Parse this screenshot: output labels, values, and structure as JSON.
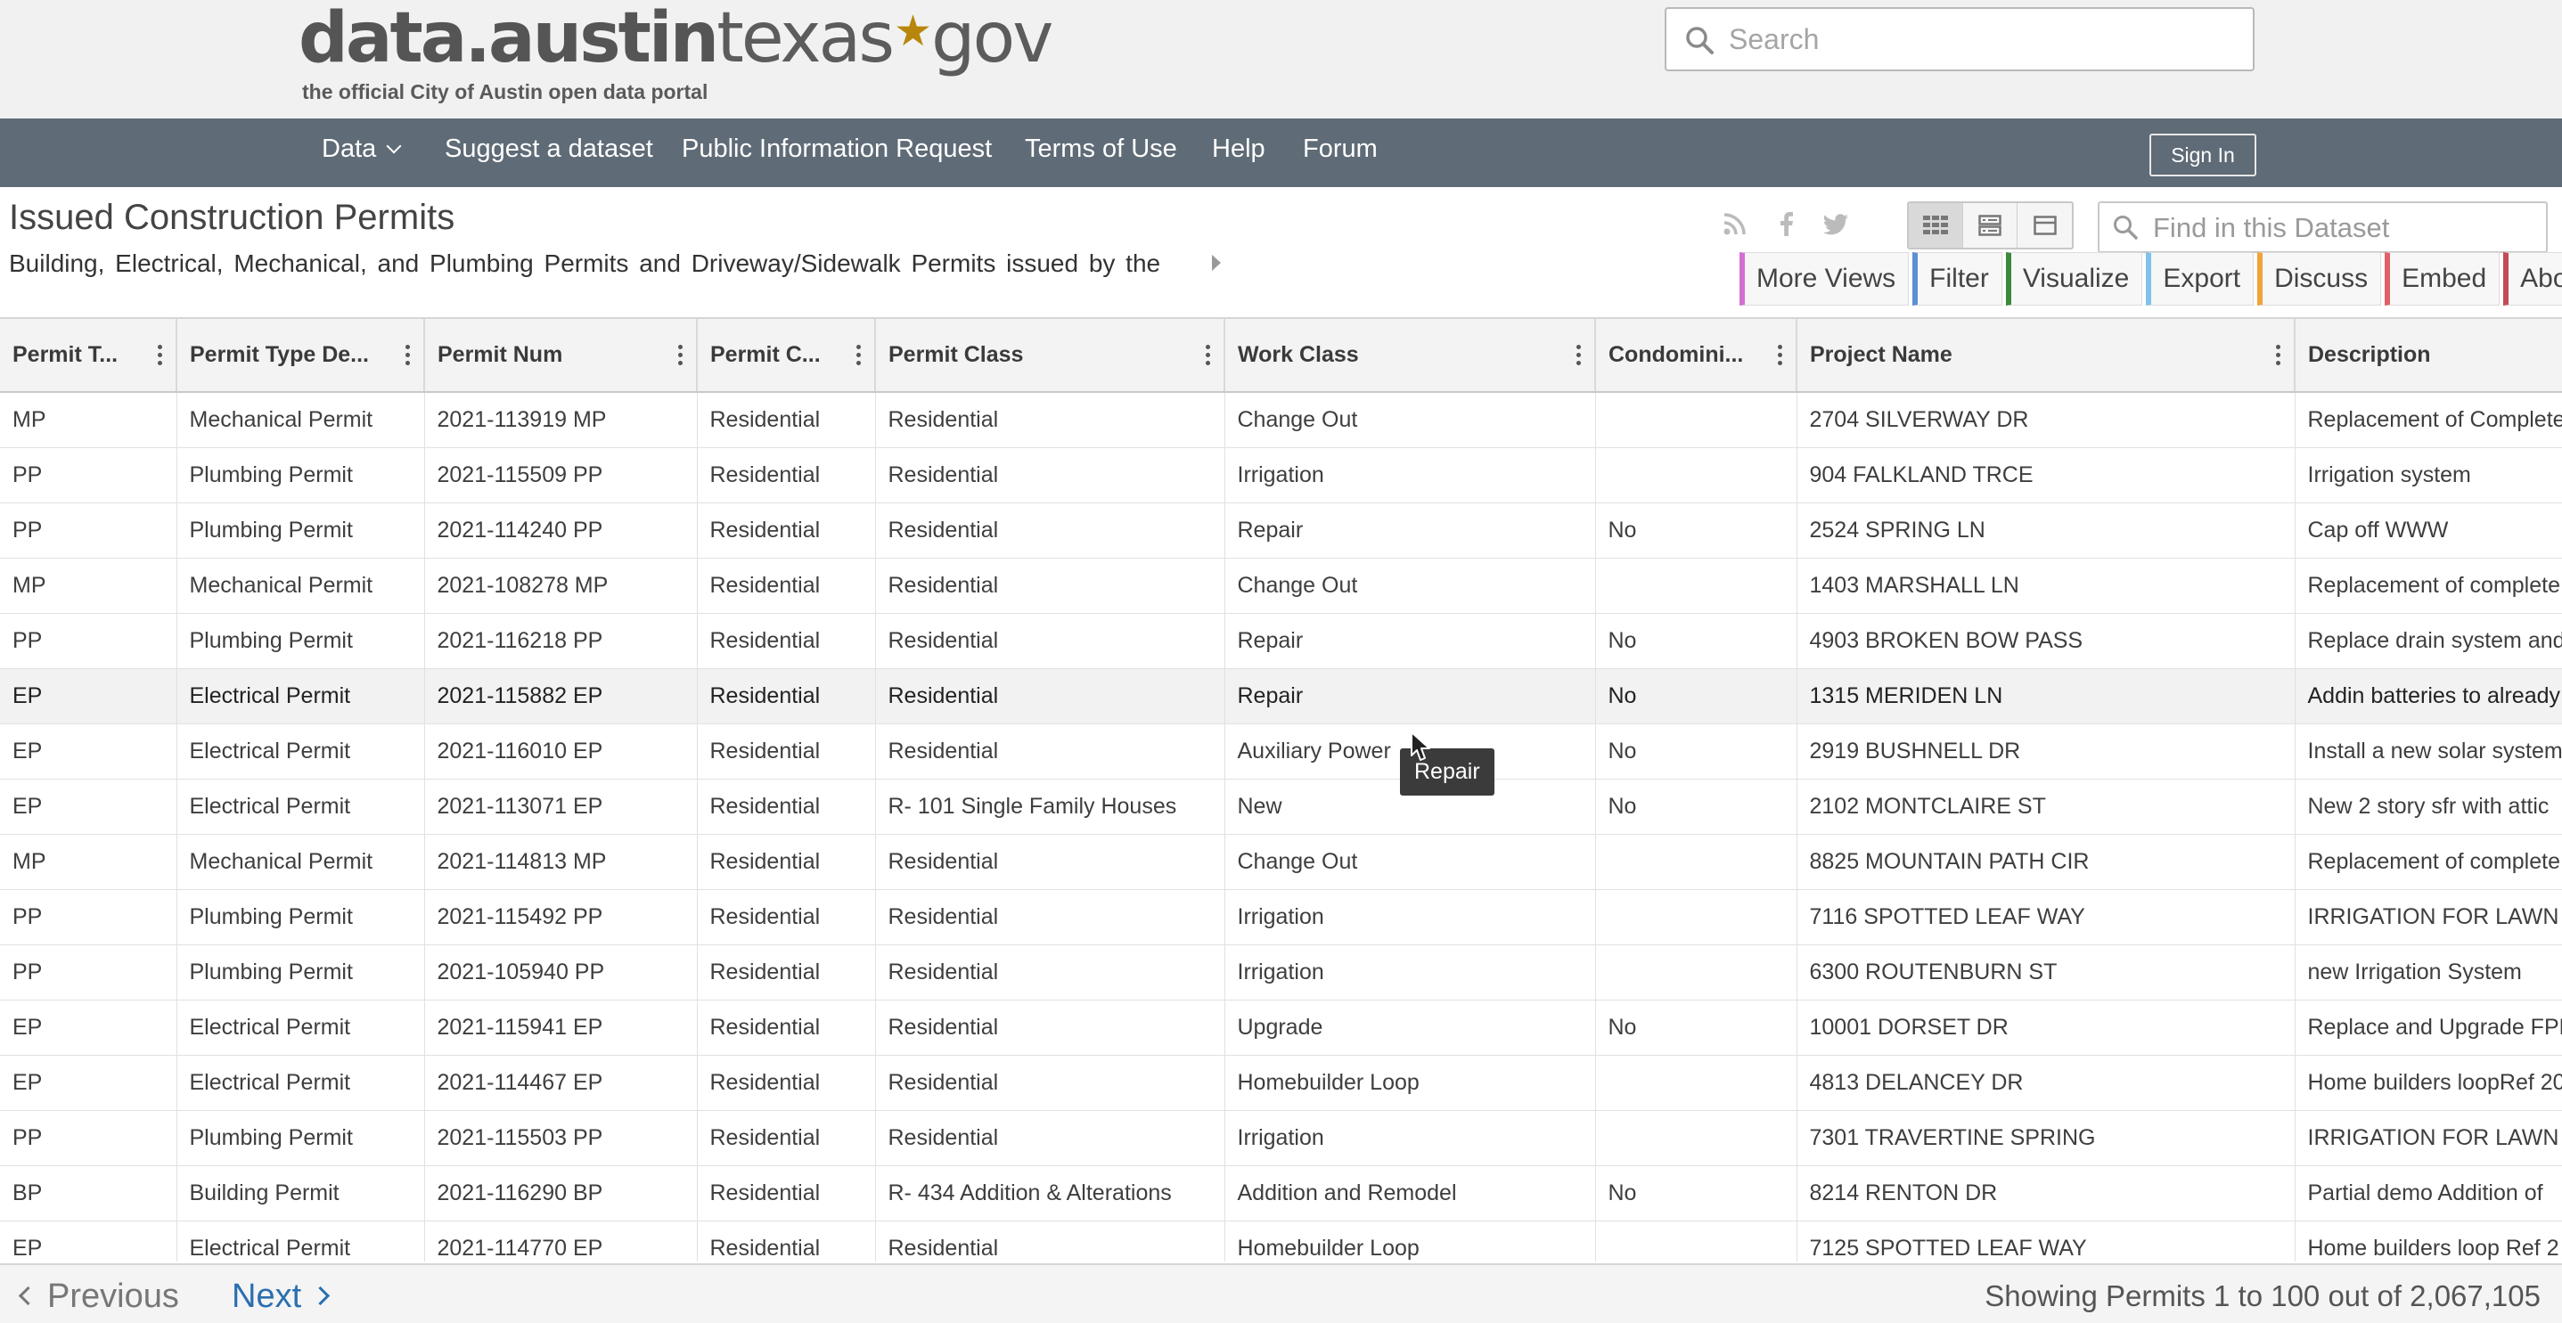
{
  "header": {
    "logo_part1": "data.",
    "logo_part2": "austin",
    "logo_part3": "texas",
    "logo_star": "★",
    "logo_part4": "gov",
    "logo_subtitle": "the official City of Austin open data portal",
    "search_placeholder": "Search"
  },
  "nav": {
    "items": [
      "Data",
      "Suggest a dataset",
      "Public Information Request",
      "Terms of Use",
      "Help",
      "Forum"
    ],
    "sign_in": "Sign In"
  },
  "dataset": {
    "title": "Issued Construction Permits",
    "description": "Building, Electrical, Mechanical, and Plumbing Permits and Driveway/Sidewalk Permits issued by the",
    "find_placeholder": "Find in this Dataset",
    "actions": [
      {
        "label": "More Views",
        "color": "#d36fd3"
      },
      {
        "label": "Filter",
        "color": "#5b8fd6"
      },
      {
        "label": "Visualize",
        "color": "#3b8a3b"
      },
      {
        "label": "Export",
        "color": "#7ec3e8"
      },
      {
        "label": "Discuss",
        "color": "#f0a33a"
      },
      {
        "label": "Embed",
        "color": "#e0606a"
      },
      {
        "label": "About",
        "color": "#c44a56"
      }
    ]
  },
  "table": {
    "columns": [
      "Permit T...",
      "Permit Type De...",
      "Permit Num",
      "Permit C...",
      "Permit Class",
      "Work Class",
      "Condomini...",
      "Project Name",
      "Description"
    ],
    "rows": [
      [
        "MP",
        "Mechanical Permit",
        "2021-113919 MP",
        "Residential",
        "Residential",
        "Change Out",
        "",
        "2704 SILVERWAY DR",
        "Replacement of Complete"
      ],
      [
        "PP",
        "Plumbing Permit",
        "2021-115509 PP",
        "Residential",
        "Residential",
        "Irrigation",
        "",
        "904 FALKLAND TRCE",
        "Irrigation system"
      ],
      [
        "PP",
        "Plumbing Permit",
        "2021-114240 PP",
        "Residential",
        "Residential",
        "Repair",
        "No",
        "2524 SPRING LN",
        "Cap off WWW"
      ],
      [
        "MP",
        "Mechanical Permit",
        "2021-108278 MP",
        "Residential",
        "Residential",
        "Change Out",
        "",
        "1403 MARSHALL LN",
        "Replacement of complete"
      ],
      [
        "PP",
        "Plumbing Permit",
        "2021-116218 PP",
        "Residential",
        "Residential",
        "Repair",
        "No",
        "4903 BROKEN BOW PASS",
        "Replace drain system and"
      ],
      [
        "EP",
        "Electrical Permit",
        "2021-115882 EP",
        "Residential",
        "Residential",
        "Repair",
        "No",
        "1315 MERIDEN LN",
        "Addin batteries to already"
      ],
      [
        "EP",
        "Electrical Permit",
        "2021-116010 EP",
        "Residential",
        "Residential",
        "Auxiliary Power",
        "No",
        "2919 BUSHNELL DR",
        "Install a new solar system"
      ],
      [
        "EP",
        "Electrical Permit",
        "2021-113071 EP",
        "Residential",
        "R- 101 Single Family Houses",
        "New",
        "No",
        "2102 MONTCLAIRE ST",
        "New 2 story sfr with attic"
      ],
      [
        "MP",
        "Mechanical Permit",
        "2021-114813 MP",
        "Residential",
        "Residential",
        "Change Out",
        "",
        "8825 MOUNTAIN PATH CIR",
        "Replacement of complete"
      ],
      [
        "PP",
        "Plumbing Permit",
        "2021-115492 PP",
        "Residential",
        "Residential",
        "Irrigation",
        "",
        "7116 SPOTTED LEAF WAY",
        "IRRIGATION FOR LAWN"
      ],
      [
        "PP",
        "Plumbing Permit",
        "2021-105940 PP",
        "Residential",
        "Residential",
        "Irrigation",
        "",
        "6300 ROUTENBURN ST",
        "new Irrigation System"
      ],
      [
        "EP",
        "Electrical Permit",
        "2021-115941 EP",
        "Residential",
        "Residential",
        "Upgrade",
        "No",
        "10001 DORSET DR",
        "Replace and Upgrade FPE"
      ],
      [
        "EP",
        "Electrical Permit",
        "2021-114467 EP",
        "Residential",
        "Residential",
        "Homebuilder Loop",
        "",
        "4813 DELANCEY DR",
        "Home builders loopRef 20"
      ],
      [
        "PP",
        "Plumbing Permit",
        "2021-115503 PP",
        "Residential",
        "Residential",
        "Irrigation",
        "",
        "7301 TRAVERTINE SPRING",
        "IRRIGATION FOR LAWN"
      ],
      [
        "BP",
        "Building Permit",
        "2021-116290 BP",
        "Residential",
        "R- 434 Addition & Alterations",
        "Addition and Remodel",
        "No",
        "8214 RENTON DR",
        "Partial demo Addition of"
      ],
      [
        "EP",
        "Electrical Permit",
        "2021-114770 EP",
        "Residential",
        "Residential",
        "Homebuilder Loop",
        "",
        "7125 SPOTTED LEAF WAY",
        "Home builders loop Ref 2"
      ]
    ],
    "tooltip": "Repair"
  },
  "pager": {
    "previous": "Previous",
    "next": "Next",
    "status": "Showing Permits 1 to 100 out of 2,067,105"
  },
  "icons": {
    "search": "search-icon",
    "rss": "rss-icon",
    "facebook": "facebook-icon",
    "twitter": "twitter-icon"
  }
}
